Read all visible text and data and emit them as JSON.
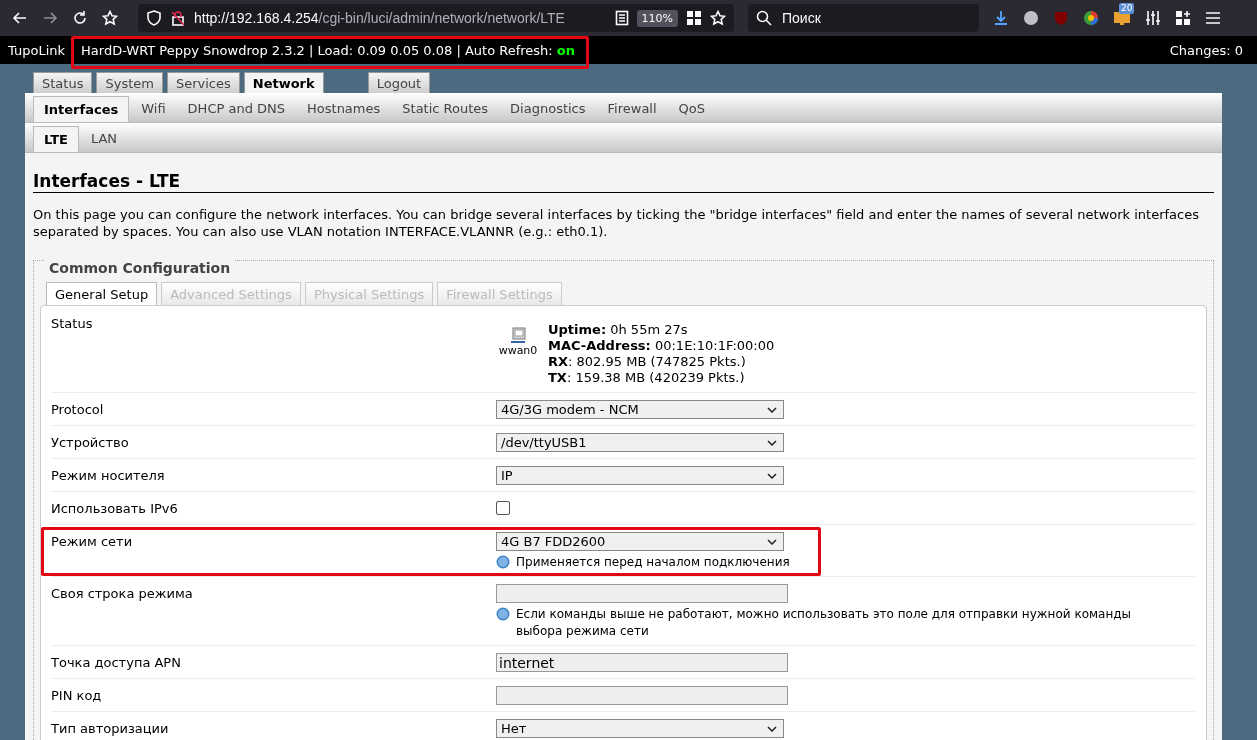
{
  "browser": {
    "url_host": "http://192.168.4.254",
    "url_path": "/cgi-bin/luci/admin/network/network/LTE",
    "zoom": "110%",
    "search": {
      "placeholder": "Поиск"
    },
    "badge": "20"
  },
  "header": {
    "brand": "TupoLink",
    "info": "HardD-WRT Peppy Snowdrop 2.3.2 | Load: 0.09 0.05 0.08 | Auto Refresh:",
    "refresh": "on",
    "changes": "Changes: 0",
    "highlighted": true
  },
  "main_tabs": [
    {
      "label": "Status",
      "selected": false
    },
    {
      "label": "System",
      "selected": false
    },
    {
      "label": "Services",
      "selected": false
    },
    {
      "label": "Network",
      "selected": true
    },
    {
      "label": "Logout",
      "selected": false
    }
  ],
  "sub_tabs": [
    {
      "label": "Interfaces",
      "selected": true
    },
    {
      "label": "Wifi",
      "selected": false
    },
    {
      "label": "DHCP and DNS",
      "selected": false
    },
    {
      "label": "Hostnames",
      "selected": false
    },
    {
      "label": "Static Routes",
      "selected": false
    },
    {
      "label": "Diagnostics",
      "selected": false
    },
    {
      "label": "Firewall",
      "selected": false
    },
    {
      "label": "QoS",
      "selected": false
    }
  ],
  "iface_tabs": [
    {
      "label": "LTE",
      "selected": true
    },
    {
      "label": "LAN",
      "selected": false
    }
  ],
  "page": {
    "title": "Interfaces - LTE",
    "description": "On this page you can configure the network interfaces. You can bridge several interfaces by ticking the \"bridge interfaces\" field and enter the names of several network interfaces separated by spaces. You can also use VLAN notation INTERFACE.VLANNR (e.g.: eth0.1)."
  },
  "section": {
    "legend": "Common Configuration",
    "tabs": [
      {
        "label": "General Setup",
        "selected": true
      },
      {
        "label": "Advanced Settings",
        "selected": false
      },
      {
        "label": "Physical Settings",
        "selected": false
      },
      {
        "label": "Firewall Settings",
        "selected": false
      }
    ]
  },
  "status": {
    "label": "Status",
    "device": "wwan0",
    "lines": [
      {
        "key": "Uptime:",
        "value": "0h 55m 27s"
      },
      {
        "key": "MAC-Address:",
        "value": "00:1E:10:1F:00:00"
      },
      {
        "key": "RX",
        "value": ": 802.95 MB (747825 Pkts.)"
      },
      {
        "key": "TX",
        "value": ": 159.38 MB (420239 Pkts.)"
      }
    ]
  },
  "fields": [
    {
      "kind": "select",
      "label": "Protocol",
      "value": "4G/3G modem - NCM",
      "highlighted": false
    },
    {
      "kind": "select",
      "label": "Устройство",
      "value": "/dev/ttyUSB1",
      "highlighted": false
    },
    {
      "kind": "select",
      "label": "Режим носителя",
      "value": "IP",
      "highlighted": false
    },
    {
      "kind": "checkbox",
      "label": "Использовать IPv6",
      "checked": false,
      "highlighted": false
    },
    {
      "kind": "select",
      "label": "Режим сети",
      "value": "4G B7 FDD2600",
      "hint": "Применяется перед началом подключения",
      "highlighted": true
    },
    {
      "kind": "text",
      "label": "Своя строка режима",
      "hint": "Если команды выше не работают, можно использовать это поле для отправки нужной команды выбора режима сети",
      "highlighted": false
    },
    {
      "kind": "text",
      "label": "Точка доступа APN",
      "value": "internet",
      "highlighted": false
    },
    {
      "kind": "text",
      "label": "PIN код",
      "highlighted": false
    },
    {
      "kind": "select",
      "label": "Тип авторизации",
      "value": "Нет",
      "highlighted": false
    }
  ]
}
